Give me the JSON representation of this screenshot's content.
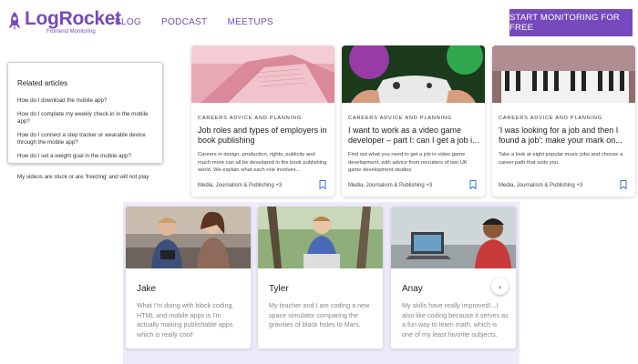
{
  "header": {
    "logo_name": "LogRocket",
    "logo_sub": "Frontend Monitoring",
    "nav": [
      "BLOG",
      "PODCAST",
      "MEETUPS"
    ],
    "cta": "START MONITORING FOR FREE"
  },
  "related": {
    "title": "Related articles",
    "items": [
      "How do I download the mobile app?",
      "How do I complete my weekly check-in in the mobile app?",
      "How do I connect a step tracker or wearable device through the mobile app?",
      "How do I set a weight goal in the mobile app?"
    ],
    "overflow_item": "My videos are stuck or are 'freezing' and will not play"
  },
  "articles": [
    {
      "tag": "CAREERS ADVICE AND PLANNING",
      "title": "Job roles and types of employers in book publishing",
      "desc": "Careers in design, production, rights, publicity and much more can all be developed in the book publishing world. We explain what each role involves...",
      "footer": "Media, Journalism & Publishing +3"
    },
    {
      "tag": "CAREERS ADVICE AND PLANNING",
      "title": "I want to work as a video game developer – part I: can I get a job i...",
      "desc": "Find out what you need to get a job in video game development, with advice from recruiters of two UK game development studios",
      "footer": "Media, Journalism & Publishing +3"
    },
    {
      "tag": "CAREERS ADVICE AND PLANNING",
      "title": "'I was looking for a job and then I found a job': make your mark on...",
      "desc": "Take a look at eight popular music jobs and choose a career path that suits you.",
      "footer": "Media, Journalism & Publishing +3"
    }
  ],
  "people": [
    {
      "name": "Jake",
      "quote": "What I'm doing with block coding, HTML and mobile apps is I'm actually making publishable apps which is really cool!"
    },
    {
      "name": "Tyler",
      "quote": "My teacher and I are coding a new space simulator comparing the gravities of black holes to Mars."
    },
    {
      "name": "Anay",
      "quote": "My skills have really improved!...I also like coding because it serves as a fun way to learn math, which is one of my least favorite subjects."
    }
  ],
  "carousel_next": "›",
  "colors": {
    "brand": "#764abc",
    "section_bg": "#eeeafb",
    "bookmark": "#3b6fd4"
  }
}
